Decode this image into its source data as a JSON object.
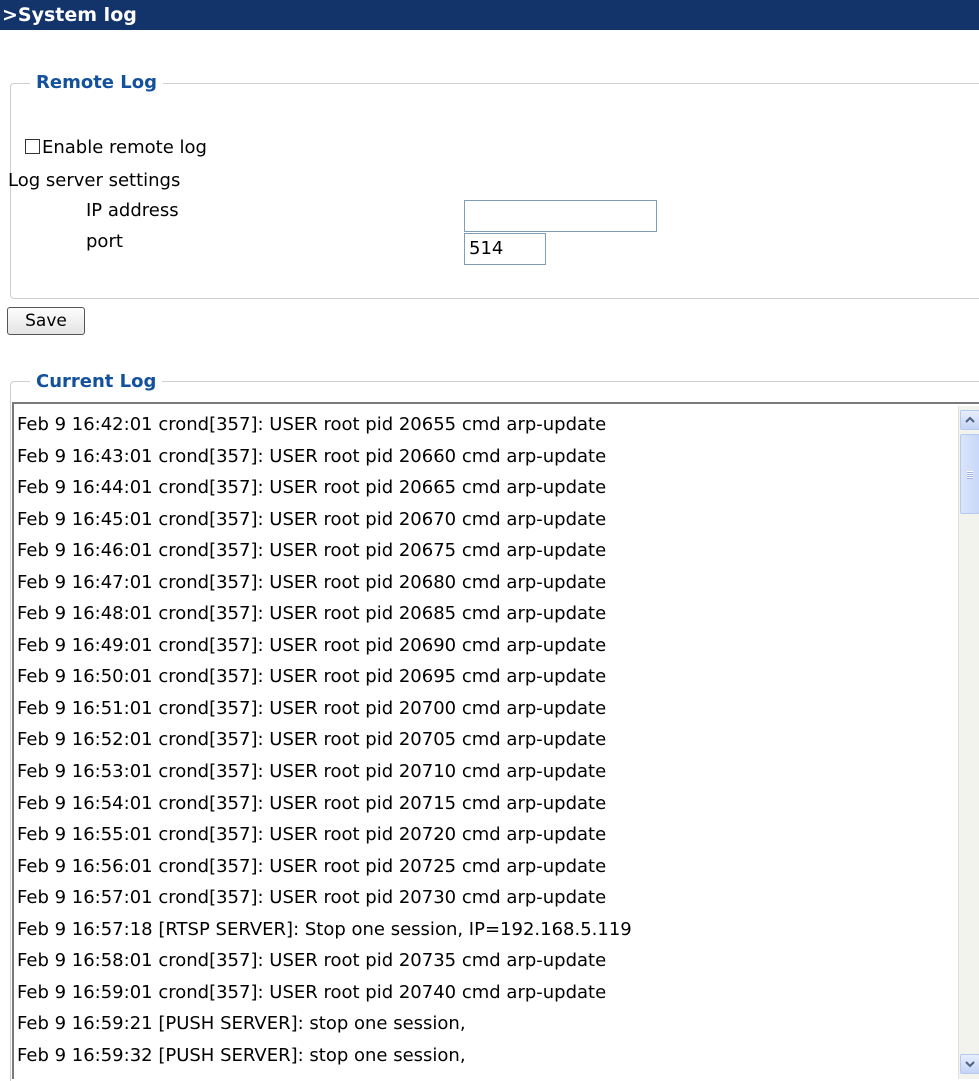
{
  "page": {
    "title": ">System log"
  },
  "remote_log": {
    "legend": "Remote Log",
    "enable_label": "Enable remote log",
    "enable_checked": false,
    "server_settings_label": "Log server settings",
    "ip_label": "IP address",
    "ip_value": "",
    "port_label": "port",
    "port_value": "514"
  },
  "save_label": "Save",
  "current_log": {
    "legend": "Current Log",
    "lines": [
      "Feb 9 16:42:01 crond[357]: USER root pid 20655 cmd arp-update",
      "Feb 9 16:43:01 crond[357]: USER root pid 20660 cmd arp-update",
      "Feb 9 16:44:01 crond[357]: USER root pid 20665 cmd arp-update",
      "Feb 9 16:45:01 crond[357]: USER root pid 20670 cmd arp-update",
      "Feb 9 16:46:01 crond[357]: USER root pid 20675 cmd arp-update",
      "Feb 9 16:47:01 crond[357]: USER root pid 20680 cmd arp-update",
      "Feb 9 16:48:01 crond[357]: USER root pid 20685 cmd arp-update",
      "Feb 9 16:49:01 crond[357]: USER root pid 20690 cmd arp-update",
      "Feb 9 16:50:01 crond[357]: USER root pid 20695 cmd arp-update",
      "Feb 9 16:51:01 crond[357]: USER root pid 20700 cmd arp-update",
      "Feb 9 16:52:01 crond[357]: USER root pid 20705 cmd arp-update",
      "Feb 9 16:53:01 crond[357]: USER root pid 20710 cmd arp-update",
      "Feb 9 16:54:01 crond[357]: USER root pid 20715 cmd arp-update",
      "Feb 9 16:55:01 crond[357]: USER root pid 20720 cmd arp-update",
      "Feb 9 16:56:01 crond[357]: USER root pid 20725 cmd arp-update",
      "Feb 9 16:57:01 crond[357]: USER root pid 20730 cmd arp-update",
      "Feb 9 16:57:18 [RTSP SERVER]: Stop one session, IP=192.168.5.119",
      "Feb 9 16:58:01 crond[357]: USER root pid 20735 cmd arp-update",
      "Feb 9 16:59:01 crond[357]: USER root pid 20740 cmd arp-update",
      "Feb 9 16:59:21 [PUSH SERVER]: stop one session,",
      "Feb 9 16:59:32 [PUSH SERVER]: stop one session,"
    ]
  },
  "icons": {
    "scroll_up": "chevron-up-icon",
    "scroll_down": "chevron-down-icon"
  }
}
